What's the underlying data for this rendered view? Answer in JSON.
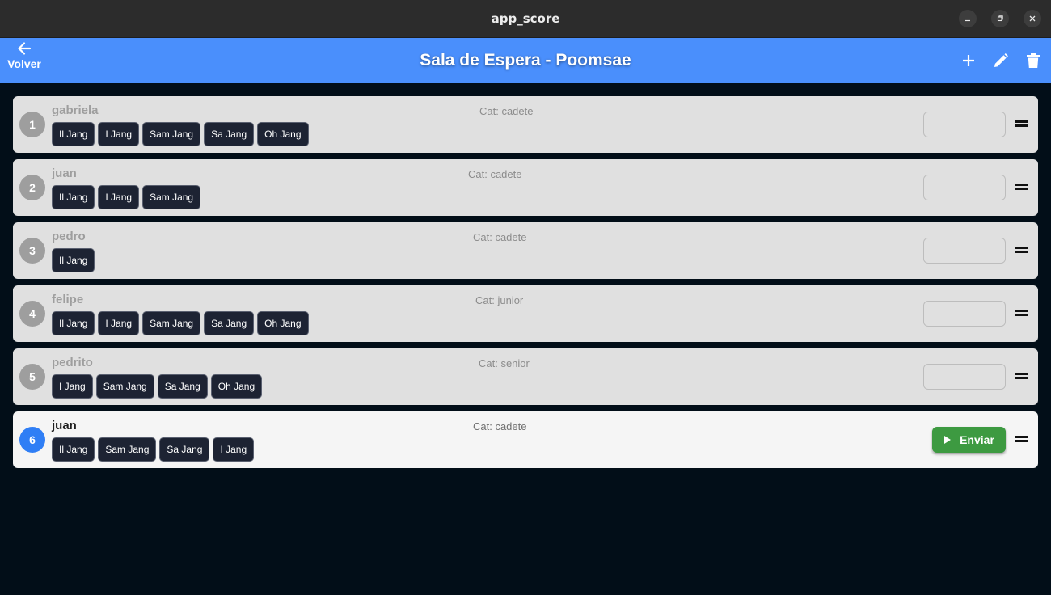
{
  "window": {
    "title": "app_score"
  },
  "appbar": {
    "back_label": "Volver",
    "title": "Sala de Espera - Poomsae"
  },
  "accent_color": "#4a8ffc",
  "action_icons": [
    "add-icon",
    "edit-icon",
    "delete-icon"
  ],
  "competitors": [
    {
      "number": "1",
      "name": "gabriela",
      "category": "Cat: cadete",
      "forms": [
        "Il Jang",
        "I Jang",
        "Sam Jang",
        "Sa Jang",
        "Oh Jang"
      ],
      "active": false
    },
    {
      "number": "2",
      "name": "juan",
      "category": "Cat: cadete",
      "forms": [
        "Il Jang",
        "I Jang",
        "Sam Jang"
      ],
      "active": false
    },
    {
      "number": "3",
      "name": "pedro",
      "category": "Cat: cadete",
      "forms": [
        "Il Jang"
      ],
      "active": false
    },
    {
      "number": "4",
      "name": "felipe",
      "category": "Cat: junior",
      "forms": [
        "Il Jang",
        "I Jang",
        "Sam Jang",
        "Sa Jang",
        "Oh Jang"
      ],
      "active": false
    },
    {
      "number": "5",
      "name": "pedrito",
      "category": "Cat: senior",
      "forms": [
        "I Jang",
        "Sam Jang",
        "Sa Jang",
        "Oh Jang"
      ],
      "active": false
    },
    {
      "number": "6",
      "name": "juan",
      "category": "Cat: cadete",
      "forms": [
        "Il Jang",
        "Sam Jang",
        "Sa Jang",
        "I Jang"
      ],
      "active": true,
      "send_label": "Enviar"
    }
  ]
}
